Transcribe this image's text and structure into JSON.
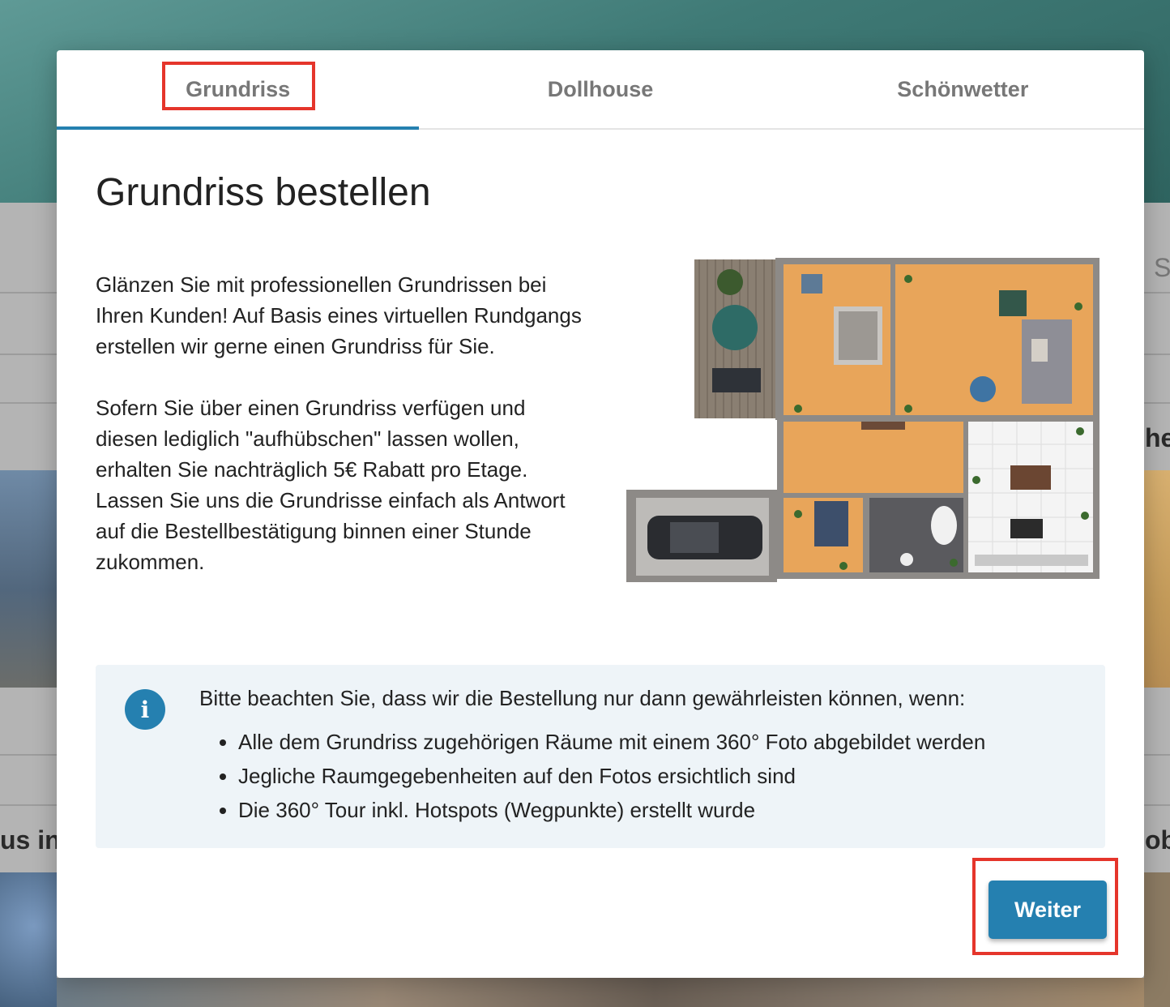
{
  "tabs": [
    {
      "label": "Grundriss",
      "active": true
    },
    {
      "label": "Dollhouse",
      "active": false
    },
    {
      "label": "Schönwetter",
      "active": false
    }
  ],
  "modal": {
    "title": "Grundriss bestellen",
    "paragraphs": [
      "Glänzen Sie mit professionellen Grundrissen bei Ihren Kunden! Auf Basis eines virtuellen Rundgangs erstellen wir gerne einen Grundriss für Sie.",
      "Sofern Sie über einen Grundriss verfügen und diesen lediglich \"aufhübschen\" lassen wollen, erhalten Sie nachträglich 5€ Rabatt pro Etage. Lassen Sie uns die Grundrisse einfach als Antwort auf die Bestellbestätigung binnen einer Stunde zukommen."
    ],
    "notice": {
      "icon": "info-icon",
      "text": "Bitte beachten Sie, dass wir die Bestellung nur dann gewährleisten können, wenn:",
      "items": [
        "Alle dem Grundriss zugehörigen Räume mit einem 360° Foto abgebildet werden",
        "Jegliche Raumgegebenheiten auf den Fotos ersichtlich sind",
        "Die 360° Tour inkl. Hotspots (Wegpunkte) erstellt wurde"
      ]
    },
    "next_button": "Weiter"
  },
  "background": {
    "fragment_left": "us in",
    "fragment_right_top": "he",
    "fragment_right_bottom": "ob",
    "fragment_right_small": "S"
  },
  "colors": {
    "accent": "#2580b0",
    "highlight": "#e5352b",
    "notice_bg": "#eef4f8"
  }
}
